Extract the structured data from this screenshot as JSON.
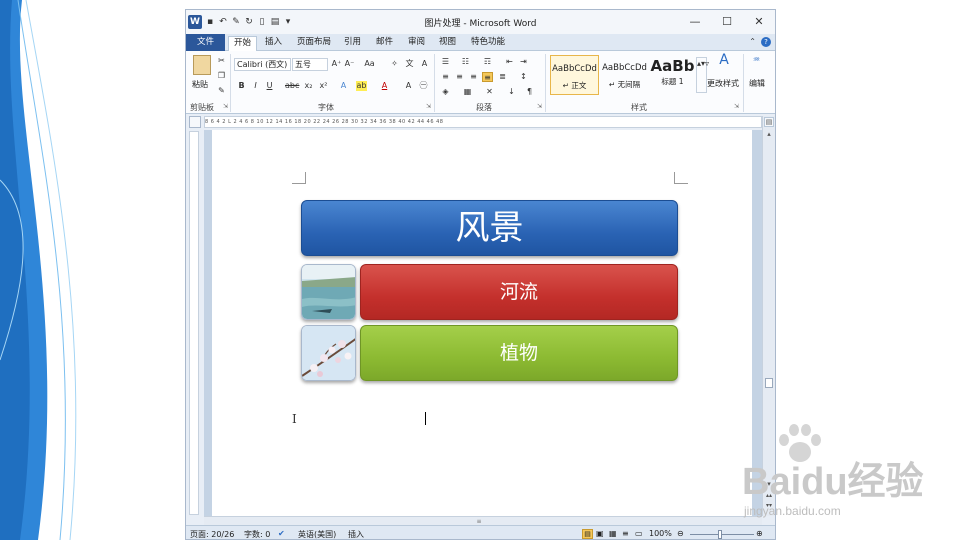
{
  "window": {
    "title": "图片处理 - Microsoft Word",
    "app_logo": "W"
  },
  "tabs": [
    {
      "label": "文件"
    },
    {
      "label": "开始"
    },
    {
      "label": "插入"
    },
    {
      "label": "页面布局"
    },
    {
      "label": "引用"
    },
    {
      "label": "邮件"
    },
    {
      "label": "审阅"
    },
    {
      "label": "视图"
    },
    {
      "label": "特色功能"
    }
  ],
  "ribbon": {
    "clipboard": {
      "paste_label": "粘贴",
      "group_label": "剪贴板"
    },
    "font": {
      "font_name": "Calibri (西文)",
      "font_size": "五号",
      "group_label": "字体",
      "bold": "B",
      "italic": "I",
      "underline": "U",
      "strike": "abc",
      "sub": "x₂",
      "sup": "x²"
    },
    "paragraph": {
      "group_label": "段落"
    },
    "styles": {
      "group_label": "样式",
      "items": [
        {
          "sample": "AaBbCcDd",
          "label": "↵ 正文"
        },
        {
          "sample": "AaBbCcDd",
          "label": "↵ 无间隔"
        },
        {
          "sample": "AaBb",
          "label": "标题 1"
        }
      ],
      "change_styles": "更改样式"
    },
    "editing": {
      "label": "编辑"
    }
  },
  "ruler": {
    "marks": "8  6  4  2  L  2  4  6  8  10  12  14  16  18  20  22  24  26  28  30  32  34  36  38  40  42  44  46  48"
  },
  "document": {
    "smartart": {
      "title": "风景",
      "items": [
        {
          "label": "河流",
          "picture": "river-image"
        },
        {
          "label": "植物",
          "picture": "plant-image"
        }
      ]
    }
  },
  "status": {
    "page": "页面: 20/26",
    "words": "字数: 0",
    "language": "英语(美国)",
    "mode": "插入",
    "zoom": "100%"
  },
  "watermark": {
    "brand": "Baidu经验",
    "url": "jingyan.baidu.com"
  },
  "colors": {
    "blue_bar": "#2a63b4",
    "red_bar": "#c4302c",
    "green_bar": "#8cba32",
    "word_blue": "#2b579a"
  }
}
